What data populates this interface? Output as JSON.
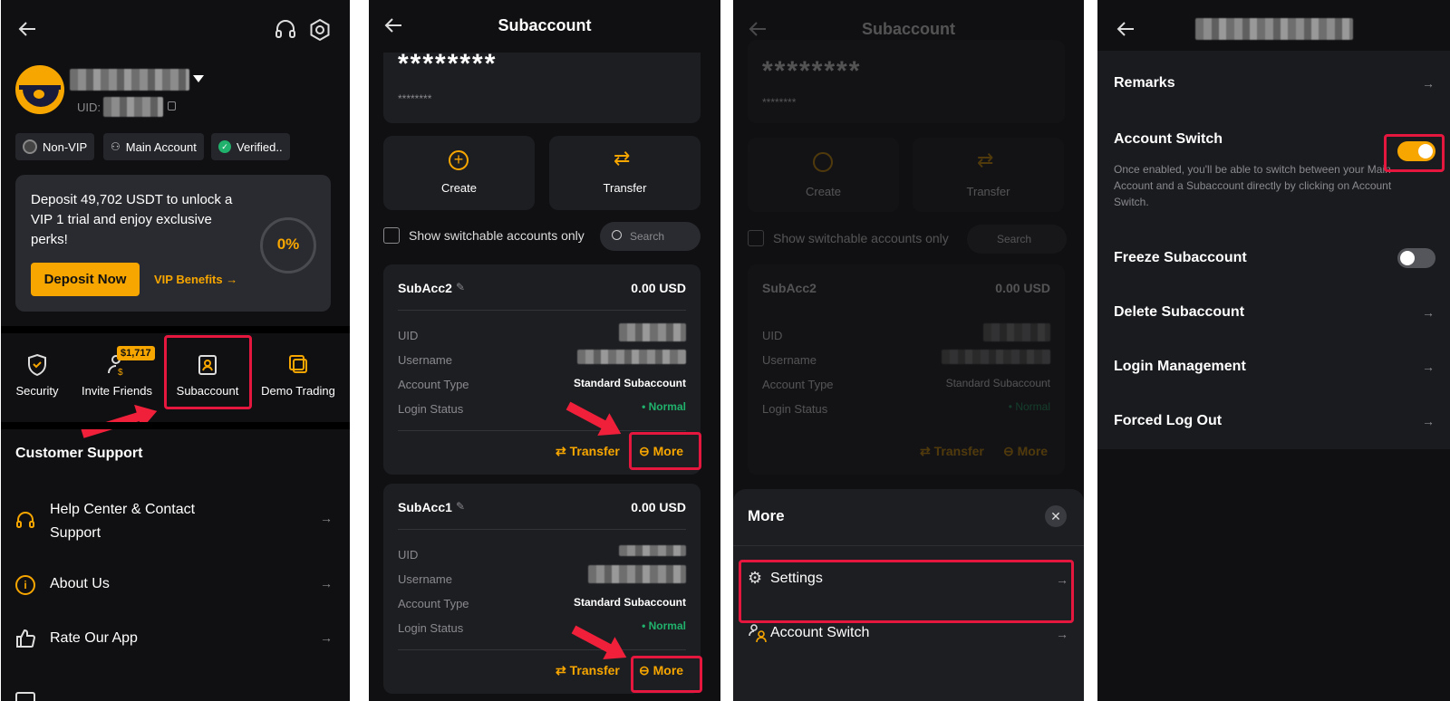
{
  "panel1": {
    "username": "",
    "uid_label": "UID:",
    "badges": [
      "Non-VIP",
      "Main Account",
      "Verified.."
    ],
    "promo": {
      "text": "Deposit 49,702 USDT to unlock a VIP 1 trial and enjoy exclusive perks!",
      "progress_label": "0%",
      "progress": 0,
      "deposit_button": "Deposit Now",
      "vip_link": "VIP Benefits →"
    },
    "shortcuts": [
      {
        "label": "Security",
        "icon": "shield-icon"
      },
      {
        "label": "Invite Friends",
        "icon": "invite-icon",
        "badge": "$1,717"
      },
      {
        "label": "Subaccount",
        "icon": "subaccount-icon"
      },
      {
        "label": "Demo Trading",
        "icon": "demo-icon"
      }
    ],
    "support_title": "Customer Support",
    "menu": [
      {
        "label": "Help Center & Contact Support",
        "icon": "headset-icon"
      },
      {
        "label": "About Us",
        "icon": "info-icon"
      },
      {
        "label": "Rate Our App",
        "icon": "thumbs-up-icon"
      }
    ]
  },
  "panel2": {
    "title": "Subaccount",
    "masked_big": "********",
    "masked_small": "********",
    "actions": [
      "Create",
      "Transfer"
    ],
    "switch_filter_label": "Show switchable accounts only",
    "search_placeholder": "Search",
    "accounts": [
      {
        "name": "SubAcc2",
        "balance": "0.00 USD",
        "labels": [
          "UID",
          "Username",
          "Account Type",
          "Login Status"
        ],
        "account_type": "Standard Subaccount",
        "login_status": "• Normal",
        "transfer": "Transfer",
        "more": "More"
      },
      {
        "name": "SubAcc1",
        "balance": "0.00 USD",
        "labels": [
          "UID",
          "Username",
          "Account Type",
          "Login Status"
        ],
        "account_type": "Standard Subaccount",
        "login_status": "• Normal",
        "transfer": "Transfer",
        "more": "More"
      }
    ]
  },
  "panel3": {
    "title": "Subaccount",
    "sheet_title": "More",
    "sheet_items": [
      "Settings",
      "Account Switch"
    ]
  },
  "panel4": {
    "settings": [
      {
        "label": "Remarks"
      },
      {
        "label": "Account Switch",
        "toggle": true,
        "on": true,
        "description": "Once enabled, you'll be able to switch between your Main Account and a Subaccount directly by clicking on Account Switch."
      },
      {
        "label": "Freeze Subaccount",
        "toggle": true,
        "on": false
      },
      {
        "label": "Delete Subaccount"
      },
      {
        "label": "Login Management"
      },
      {
        "label": "Forced Log Out"
      }
    ]
  },
  "colors": {
    "accent": "#f7a600",
    "highlight": "#e5173f",
    "success": "#20b26c",
    "background": "#101012"
  }
}
